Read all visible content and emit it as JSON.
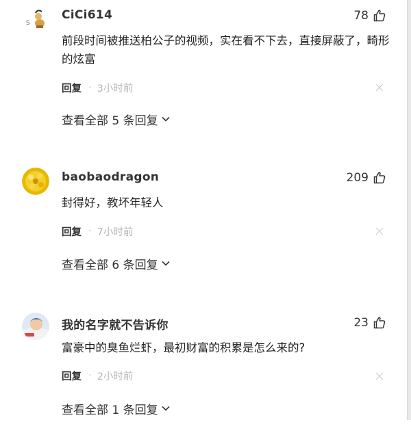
{
  "comments": [
    {
      "username": "CiCi614",
      "likes": "78",
      "content": "前段时间被推送柏公子的视频，实在看不下去，直接屏蔽了，畸形的炫富",
      "reply_label": "回复",
      "dot": "·",
      "time": "3小时前",
      "expand_text": "查看全部 5 条回复",
      "avatar_icon": "cartoon-figure-avatar"
    },
    {
      "username": "baobaodragon",
      "likes": "209",
      "content": "封得好，教坏年轻人",
      "reply_label": "回复",
      "dot": "·",
      "time": "7小时前",
      "expand_text": "查看全部 6 条回复",
      "avatar_icon": "yellow-flower-avatar"
    },
    {
      "username": "我的名字就不告诉你",
      "likes": "23",
      "content": "富豪中的臭鱼烂虾，最初财富的积累是怎么来的?",
      "reply_label": "回复",
      "dot": "·",
      "time": "2小时前",
      "expand_text": "查看全部 1 条回复",
      "avatar_icon": "person-photo-avatar"
    }
  ],
  "colors": {
    "text": "#222222",
    "muted": "#b5b5b5",
    "username": "#333333"
  }
}
